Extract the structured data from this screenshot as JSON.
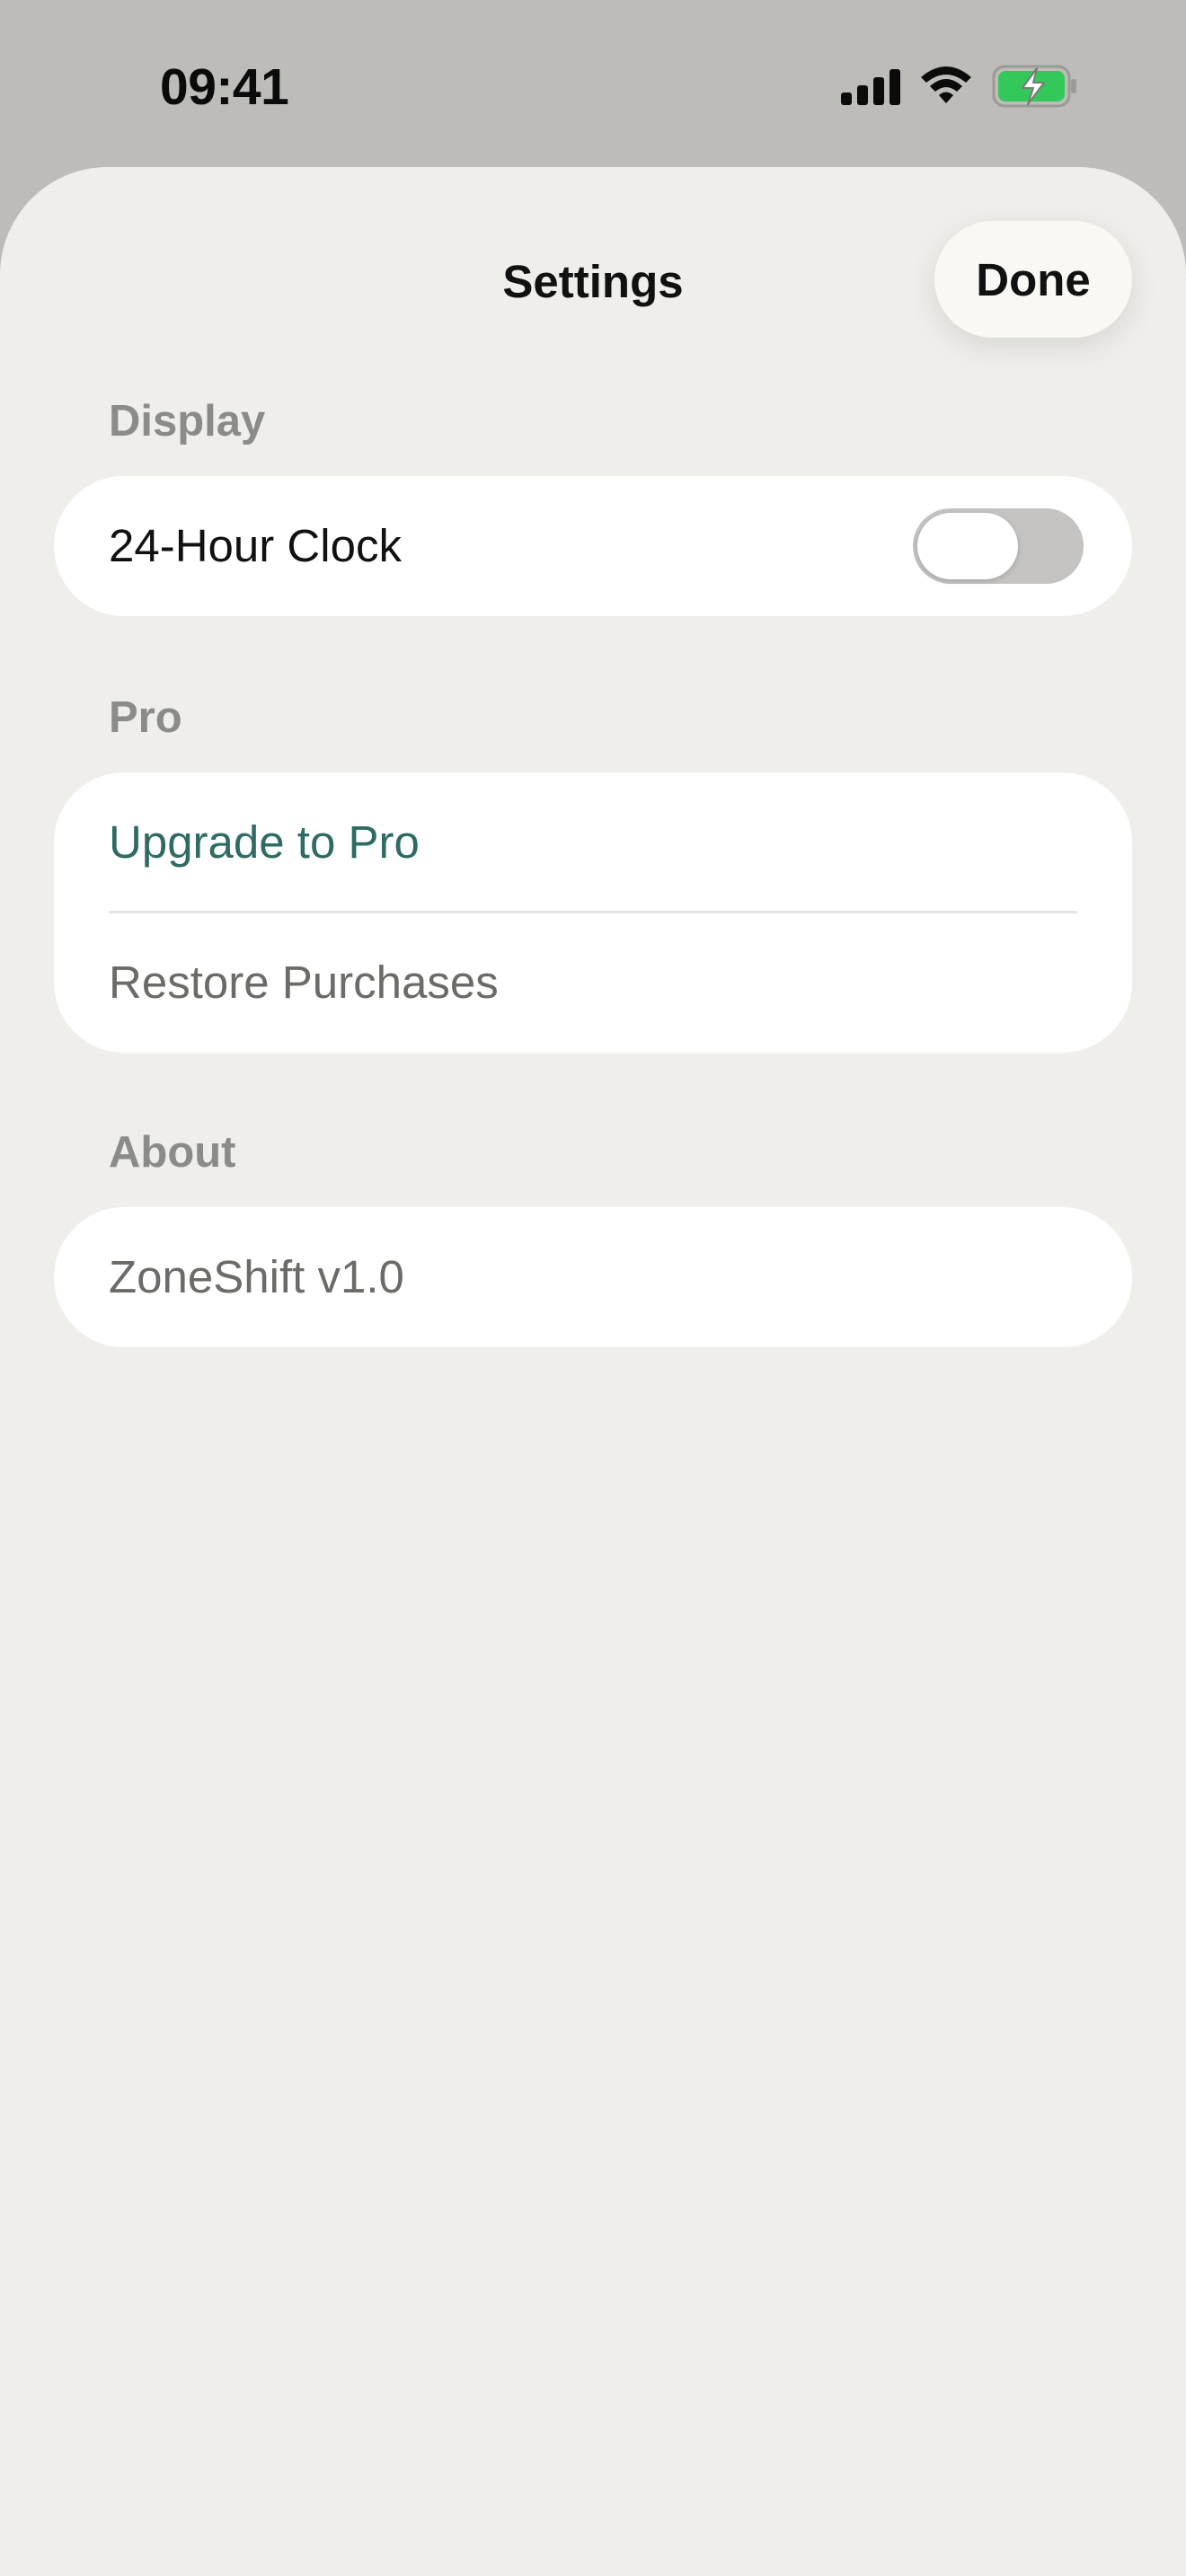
{
  "status_bar": {
    "time": "09:41",
    "icons": [
      "cellular-signal-icon",
      "wifi-icon",
      "battery-charging-icon"
    ]
  },
  "header": {
    "title": "Settings",
    "done_label": "Done"
  },
  "sections": {
    "display": {
      "header": "Display",
      "clock_label": "24-Hour Clock",
      "clock_enabled": false
    },
    "pro": {
      "header": "Pro",
      "upgrade_label": "Upgrade to Pro",
      "restore_label": "Restore Purchases"
    },
    "about": {
      "header": "About",
      "version_label": "ZoneShift v1.0"
    }
  },
  "colors": {
    "accent": "#2e6b63",
    "sheet_background": "#efeeea",
    "backdrop": "#bebcb8",
    "battery_fill": "#34c759"
  }
}
